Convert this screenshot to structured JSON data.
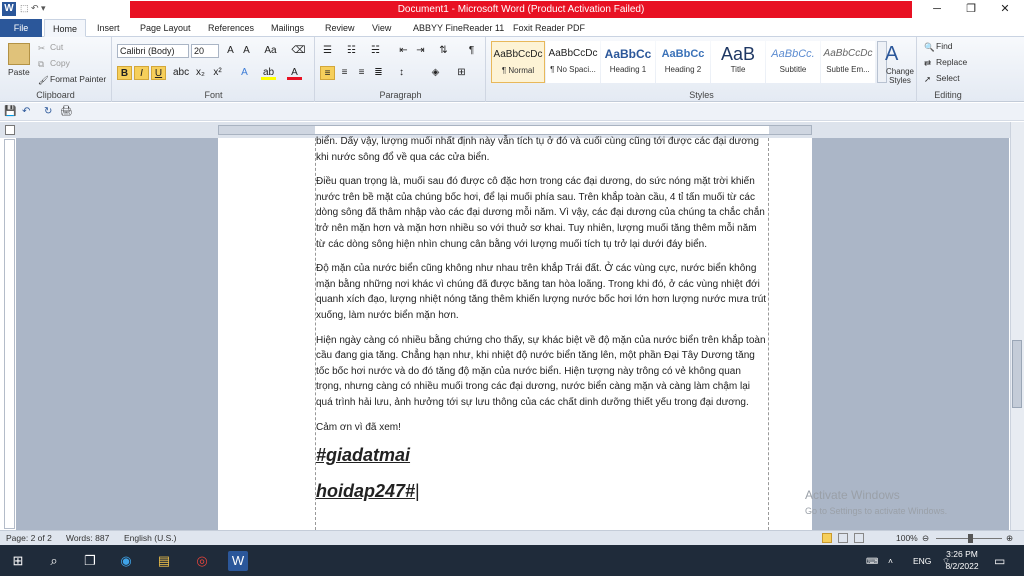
{
  "window": {
    "title": "Document1 - Microsoft Word (Product Activation Failed)",
    "qat_label": "⬚ ↶ ▾"
  },
  "tabs": [
    "Home",
    "Insert",
    "Page Layout",
    "References",
    "Mailings",
    "Review",
    "View",
    "ABBYY FineReader 11",
    "Foxit Reader PDF"
  ],
  "file_tab": "File",
  "clipboard": {
    "paste": "Paste",
    "cut": "Cut",
    "copy": "Copy",
    "painter": "Format Painter",
    "label": "Clipboard"
  },
  "font": {
    "name": "Calibri (Body)",
    "size": "20",
    "label": "Font"
  },
  "paragraph": {
    "label": "Paragraph"
  },
  "styles": {
    "label": "Styles",
    "items": [
      {
        "preview": "AaBbCcDc",
        "name": "¶ Normal"
      },
      {
        "preview": "AaBbCcDc",
        "name": "¶ No Spaci..."
      },
      {
        "preview": "AaBbCc",
        "name": "Heading 1"
      },
      {
        "preview": "AaBbCc",
        "name": "Heading 2"
      },
      {
        "preview": "AaB",
        "name": "Title"
      },
      {
        "preview": "AaBbCc.",
        "name": "Subtitle"
      },
      {
        "preview": "AaBbCcDc",
        "name": "Subtle Em..."
      }
    ],
    "change": "Change Styles"
  },
  "editing": {
    "find": "Find",
    "replace": "Replace",
    "select": "Select",
    "label": "Editing"
  },
  "document": {
    "p0": "biển. Dấy vậy, lượng muối nhất định này vẫn tích tụ ở đó và cuối cùng cũng tới được các đại dương khi nước sông đổ về qua các cửa biển.",
    "p1": "Điều quan trọng là, muối sau đó được cô đặc hơn trong các đại dương, do sức nóng mặt trời khiến nước trên bề mặt của chúng bốc hơi, để lại muối phía sau. Trên khắp toàn cầu, 4 tỉ tấn muối từ các dòng sông đã thâm nhập vào các đại dương mỗi năm. Vì vậy, các đại dương của chúng ta chắc chắn trở nên mặn hơn và mặn hơn nhiều so với thuở sơ khai. Tuy nhiên, lượng muối tăng thêm mỗi năm từ các dòng sông hiện nhìn chung cân bằng với lượng muối tích tụ trở lại dưới đáy biển.",
    "p2": "Độ mặn của nước biển cũng không như nhau trên khắp Trái đất. Ở các vùng cực, nước biển không mặn bằng những nơi khác vì chúng đã được băng tan hòa loãng. Trong khi đó, ở các vùng nhiệt đới quanh xích đạo, lượng nhiệt nóng tăng thêm khiến lượng nước bốc hơi lớn hơn lượng nước mưa trút xuống, làm nước biển mặn hơn.",
    "p3": "Hiện ngày càng có nhiều bằng chứng cho thấy, sự khác biệt về độ mặn của nước biển trên khắp toàn cầu đang gia tăng. Chẳng hạn như, khi nhiệt độ nước biển tăng lên, một phần Đại Tây Dương tăng tốc bốc hơi nước và do đó tăng độ mặn của nước biển. Hiện tượng này trông có vẻ không quan trọng, nhưng càng có nhiều muối trong các đại dương, nước biển càng mặn và càng làm chậm lại quá trình hải lưu, ảnh hưởng tới sự lưu thông của các chất dinh dưỡng thiết yếu trong đại dương.",
    "p4": "Cảm ơn vì đã xem!",
    "h1": "#giadatmai",
    "h2": "hoidap247#"
  },
  "watermark": {
    "line1": "Activate Windows",
    "line2": "Go to Settings to activate Windows."
  },
  "status": {
    "page": "Page: 2 of 2",
    "words": "Words: 887",
    "lang": "English (U.S.)",
    "zoom": "100%"
  },
  "tray": {
    "lang": "ENG",
    "time": "3:26 PM",
    "date": "8/2/2022"
  }
}
